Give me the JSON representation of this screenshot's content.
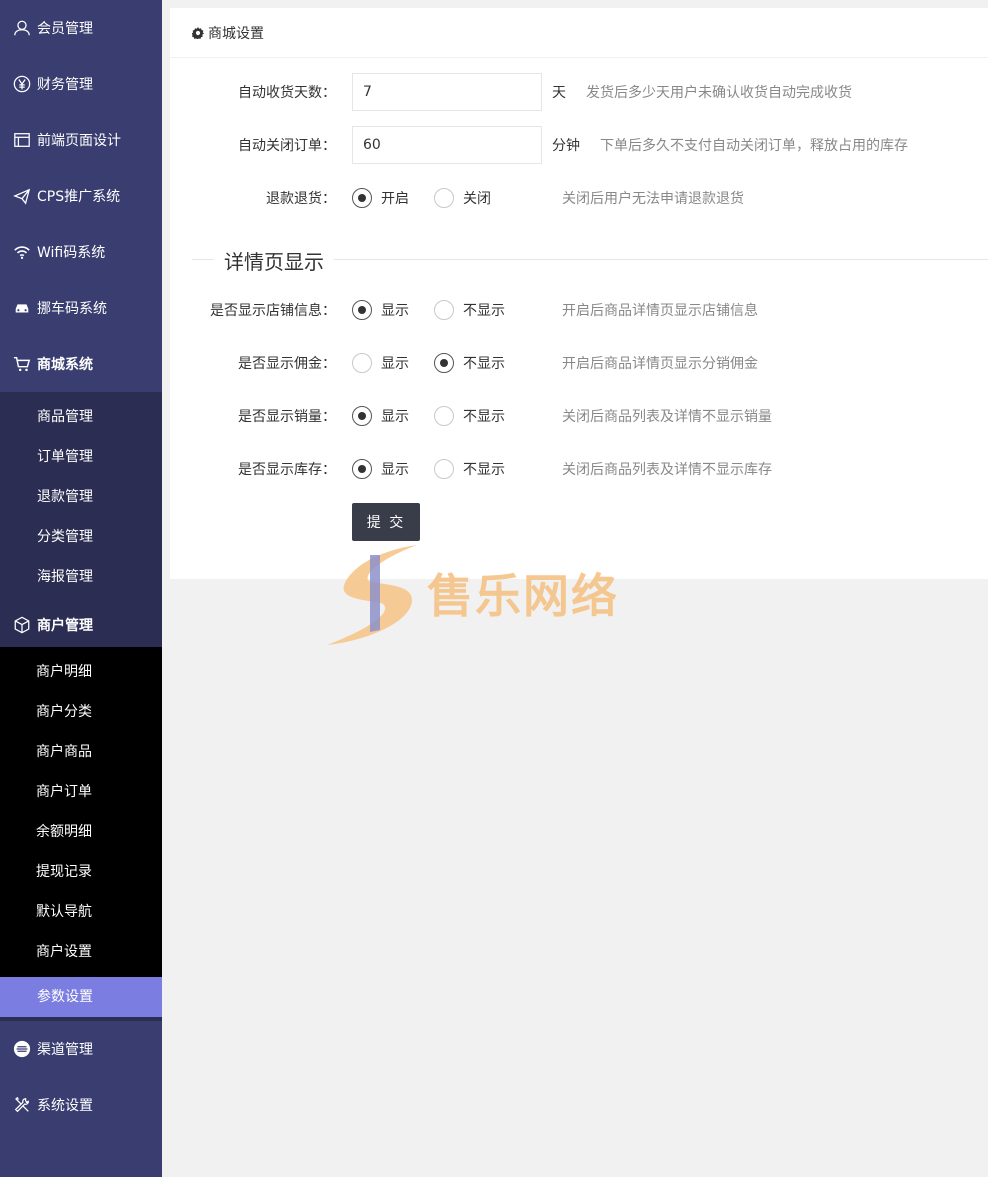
{
  "sidebar": {
    "items": [
      {
        "label": "会员管理",
        "icon": "user-icon"
      },
      {
        "label": "财务管理",
        "icon": "yen-icon"
      },
      {
        "label": "前端页面设计",
        "icon": "window-icon"
      },
      {
        "label": "CPS推广系统",
        "icon": "paper-plane-icon"
      },
      {
        "label": "Wifi码系统",
        "icon": "wifi-icon"
      },
      {
        "label": "挪车码系统",
        "icon": "car-icon"
      },
      {
        "label": "商城系统",
        "icon": "cart-icon"
      }
    ],
    "shop_sub": [
      "商品管理",
      "订单管理",
      "退款管理",
      "分类管理",
      "海报管理"
    ],
    "merchant": {
      "label": "商户管理",
      "icon": "cube-icon"
    },
    "merchant_sub": [
      "商户明细",
      "商户分类",
      "商户商品",
      "商户订单",
      "余额明细",
      "提现记录",
      "默认导航",
      "商户设置"
    ],
    "active": "参数设置",
    "bottom": [
      {
        "label": "渠道管理",
        "icon": "list-circle-icon"
      },
      {
        "label": "系统设置",
        "icon": "tools-icon"
      }
    ]
  },
  "panel": {
    "title": "商城设置",
    "auto_receive": {
      "label": "自动收货天数：",
      "value": "7",
      "unit": "天",
      "tip": "发货后多少天用户未确认收货自动完成收货"
    },
    "auto_close": {
      "label": "自动关闭订单：",
      "value": "60",
      "unit": "分钟",
      "tip": "下单后多久不支付自动关闭订单，释放占用的库存"
    },
    "refund": {
      "label": "退款退货：",
      "opt_on": "开启",
      "opt_off": "关闭",
      "selected": "开启",
      "tip": "关闭后用户无法申请退款退货"
    },
    "section_title": "详情页显示",
    "show_shop": {
      "label": "是否显示店铺信息：",
      "opt_show": "显示",
      "opt_hide": "不显示",
      "selected": "显示",
      "tip": "开启后商品详情页显示店铺信息"
    },
    "show_commission": {
      "label": "是否显示佣金：",
      "opt_show": "显示",
      "opt_hide": "不显示",
      "selected": "不显示",
      "tip": "开启后商品详情页显示分销佣金"
    },
    "show_sales": {
      "label": "是否显示销量：",
      "opt_show": "显示",
      "opt_hide": "不显示",
      "selected": "显示",
      "tip": "关闭后商品列表及详情不显示销量"
    },
    "show_stock": {
      "label": "是否显示库存：",
      "opt_show": "显示",
      "opt_hide": "不显示",
      "selected": "显示",
      "tip": "关闭后商品列表及详情不显示库存"
    },
    "submit": "提 交"
  },
  "watermark": {
    "text": "售乐网络"
  },
  "colors": {
    "sidebar": "#393d70",
    "sidebar_sub": "#2b2d52",
    "active": "#7b7de0",
    "button": "#393d49"
  }
}
